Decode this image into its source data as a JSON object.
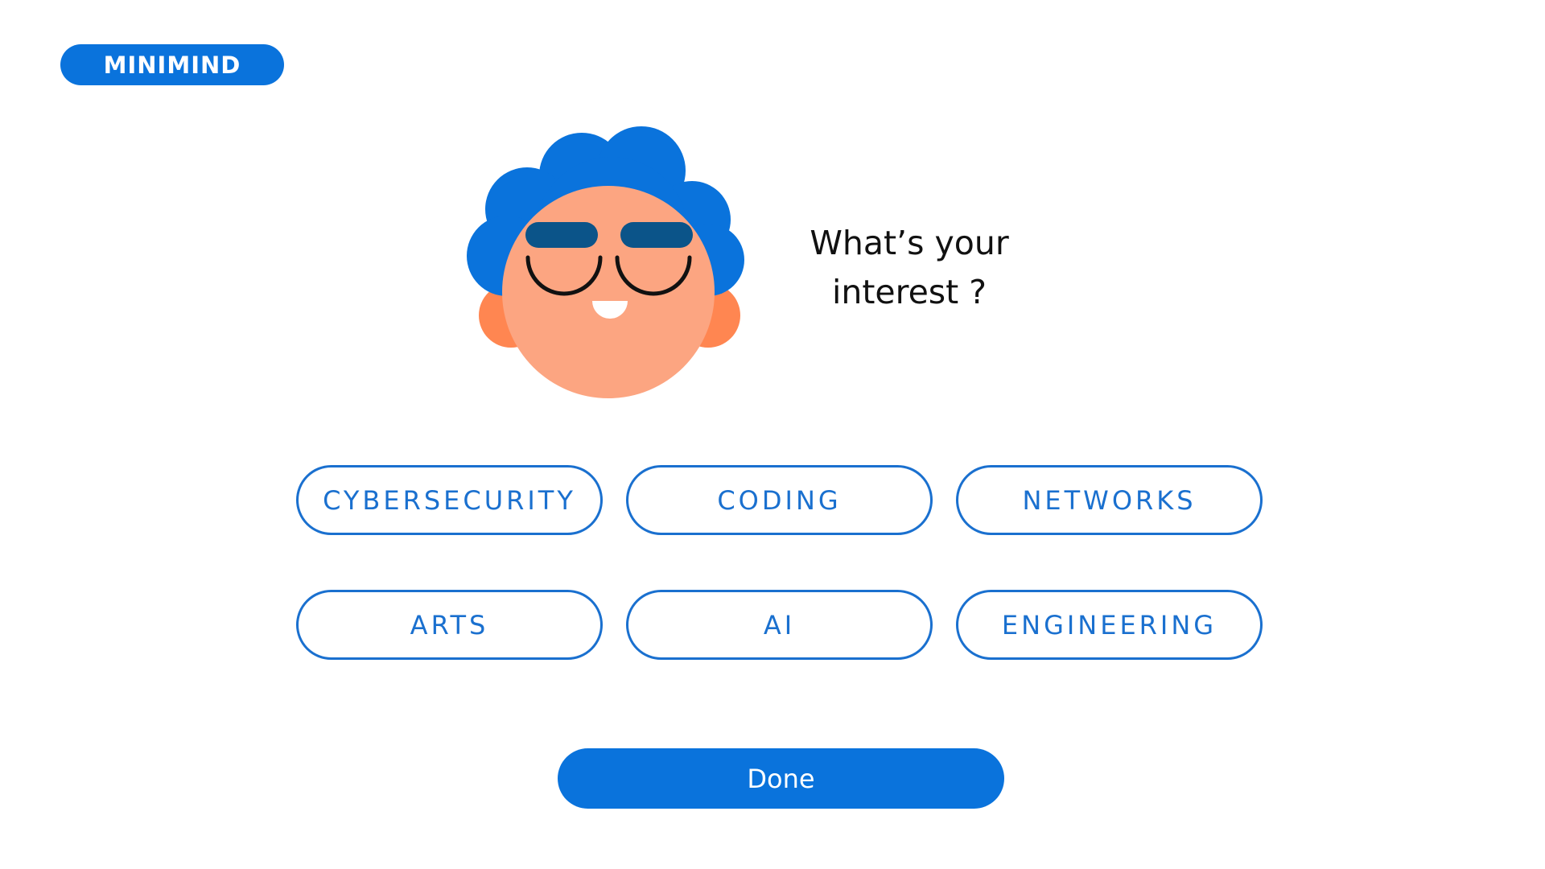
{
  "brand": {
    "logo_text": "MINIMIND"
  },
  "prompt": {
    "line1": "What’s your",
    "line2": "interest ?"
  },
  "interests": [
    {
      "label": "CYBERSECURITY"
    },
    {
      "label": "CODING"
    },
    {
      "label": "NETWORKS"
    },
    {
      "label": "ARTS"
    },
    {
      "label": "AI"
    },
    {
      "label": "ENGINEERING"
    }
  ],
  "actions": {
    "done_label": "Done"
  },
  "avatar": {
    "icon": "smiling-avatar-with-sunglasses"
  },
  "colors": {
    "brand_blue": "#0a73dc",
    "outline_blue": "#1a70cf",
    "hair": "#0a73dc",
    "skin": "#fca581",
    "ears": "#ff8651",
    "glasses": "#0b5489",
    "text_dark": "#111111",
    "background": "#ffffff"
  }
}
